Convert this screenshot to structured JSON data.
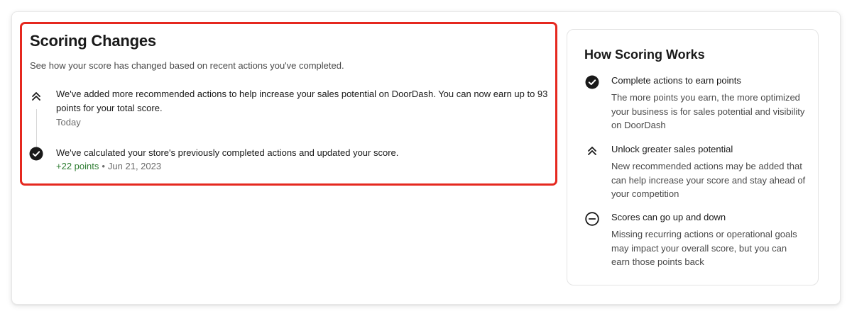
{
  "scoring_changes": {
    "title": "Scoring Changes",
    "subtitle": "See how your score has changed based on recent actions you've completed.",
    "entries": [
      {
        "icon": "double-chevron-up-icon",
        "text": "We've added more recommended actions to help increase your sales potential on DoorDash. You can now earn up to 93 points for your total score.",
        "date": "Today"
      },
      {
        "icon": "check-circle-icon",
        "text": "We've calculated your store's previously completed actions and updated your score.",
        "points": "+22 points",
        "separator": "•",
        "date": "Jun 21, 2023"
      }
    ]
  },
  "how_scoring_works": {
    "title": "How Scoring Works",
    "items": [
      {
        "icon": "check-circle-icon",
        "title": "Complete actions to earn points",
        "description": "The more points you earn, the more optimized your business is for sales potential and visibility on DoorDash"
      },
      {
        "icon": "double-chevron-up-icon",
        "title": "Unlock greater sales potential",
        "description": "New recommended actions may be added that can help increase your score and stay ahead of your competition"
      },
      {
        "icon": "minus-circle-icon",
        "title": "Scores can go up and down",
        "description": "Missing recurring actions or operational goals may impact your overall score, but you can earn those points back"
      }
    ]
  },
  "colors": {
    "highlight_border": "#e5281f",
    "points_green": "#2e7d32",
    "text_primary": "#191919",
    "text_secondary": "#6b6b6b"
  }
}
